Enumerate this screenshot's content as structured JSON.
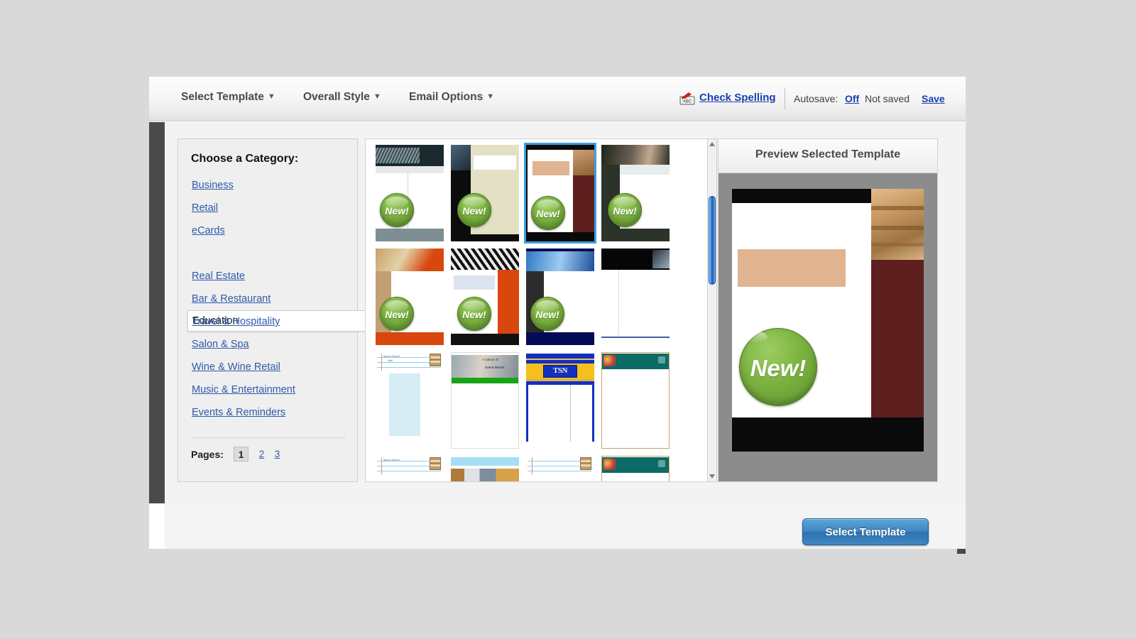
{
  "toolbar": {
    "menus": [
      {
        "label": "Select Template",
        "caret": "▼"
      },
      {
        "label": "Overall Style",
        "caret": "▼"
      },
      {
        "label": "Email Options",
        "caret": "▼"
      }
    ],
    "spell_icon": "abc-spellcheck-icon",
    "check_spelling": "Check Spelling",
    "autosave_label": "Autosave:",
    "autosave_value": "Off",
    "saved_status": "Not saved",
    "save_link": "Save"
  },
  "category_panel": {
    "title": "Choose a Category:",
    "items": [
      {
        "label": "Business",
        "selected": false
      },
      {
        "label": "Retail",
        "selected": false
      },
      {
        "label": "eCards",
        "selected": false
      },
      {
        "label": "Education",
        "selected": true
      },
      {
        "label": "Real Estate",
        "selected": false
      },
      {
        "label": "Bar & Restaurant",
        "selected": false
      },
      {
        "label": "Travel & Hospitality",
        "selected": false
      },
      {
        "label": "Salon & Spa",
        "selected": false
      },
      {
        "label": "Wine & Wine Retail",
        "selected": false
      },
      {
        "label": "Music & Entertainment",
        "selected": false
      },
      {
        "label": "Events & Reminders",
        "selected": false
      }
    ],
    "pages_label": "Pages:",
    "pages": [
      {
        "label": "1",
        "active": true
      },
      {
        "label": "2",
        "active": false
      },
      {
        "label": "3",
        "active": false
      }
    ]
  },
  "thumbnails": {
    "badge_text": "New!",
    "selected_index": 2,
    "items": [
      {
        "name": "education-template-01",
        "badge": true,
        "style": "dark-teal-header"
      },
      {
        "name": "education-template-02",
        "badge": true,
        "style": "black-cream"
      },
      {
        "name": "education-template-03",
        "badge": true,
        "style": "books-maroon"
      },
      {
        "name": "education-template-04",
        "badge": true,
        "style": "dark-green-photo"
      },
      {
        "name": "education-template-05",
        "badge": true,
        "style": "orange-tan"
      },
      {
        "name": "education-template-06",
        "badge": true,
        "style": "black-red"
      },
      {
        "name": "education-template-07",
        "badge": true,
        "style": "blue-navy"
      },
      {
        "name": "education-template-08",
        "badge": false,
        "style": "black-banner-white"
      },
      {
        "name": "education-template-09",
        "badge": false,
        "style": "notebook-back-to-school"
      },
      {
        "name": "education-template-10",
        "badge": false,
        "style": "culture-green",
        "caption": "A Culture of Great Minds"
      },
      {
        "name": "education-template-11",
        "badge": false,
        "style": "tsn-yellow-blue",
        "caption": "TSN"
      },
      {
        "name": "education-template-12",
        "badge": false,
        "style": "teal-chalkboard"
      },
      {
        "name": "education-template-13",
        "badge": false,
        "style": "notebook-back-to-school"
      },
      {
        "name": "education-template-14",
        "badge": false,
        "style": "animals-lightblue"
      },
      {
        "name": "education-template-15",
        "badge": false,
        "style": "notebook-back-to-school"
      },
      {
        "name": "education-template-16",
        "badge": false,
        "style": "teal-chalkboard"
      }
    ]
  },
  "preview": {
    "title": "Preview Selected Template",
    "badge_text": "New!"
  },
  "footer": {
    "select_template_button": "Select Template"
  },
  "colors": {
    "accent_blue": "#2e5aa8",
    "link_blue": "#1a3fb0",
    "selection_border": "#3b9fe0",
    "badge_green": "#7cb23f",
    "button_blue": "#3d86c2",
    "preview_stage": "#8c8c8c",
    "maroon": "#5e1f1f",
    "tan": "#e0b491"
  }
}
